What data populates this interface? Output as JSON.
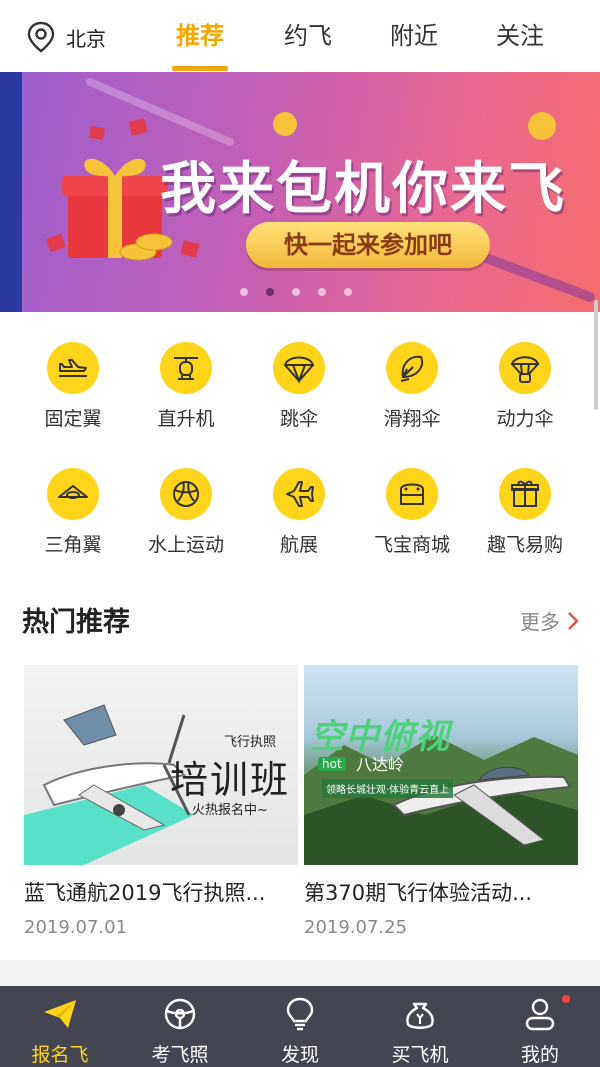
{
  "topbar": {
    "location": "北京",
    "tabs": [
      {
        "label": "推荐",
        "active": true
      },
      {
        "label": "约飞",
        "active": false
      },
      {
        "label": "附近",
        "active": false
      },
      {
        "label": "关注",
        "active": false
      }
    ]
  },
  "banner": {
    "title": "我来包机你来飞",
    "button_label": "快一起来参加吧",
    "dot_count": 5,
    "active_dot": 2
  },
  "categories": [
    {
      "label": "固定翼",
      "icon": "fixed-wing-icon"
    },
    {
      "label": "直升机",
      "icon": "helicopter-icon"
    },
    {
      "label": "跳伞",
      "icon": "parachute-icon"
    },
    {
      "label": "滑翔伞",
      "icon": "paraglider-icon"
    },
    {
      "label": "动力伞",
      "icon": "powered-paraglider-icon"
    },
    {
      "label": "三角翼",
      "icon": "hang-glider-icon"
    },
    {
      "label": "水上运动",
      "icon": "water-sports-icon"
    },
    {
      "label": "航展",
      "icon": "airshow-icon"
    },
    {
      "label": "飞宝商城",
      "icon": "store-icon"
    },
    {
      "label": "趣飞易购",
      "icon": "gift-icon"
    }
  ],
  "hot": {
    "title": "热门推荐",
    "more_label": "更多",
    "cards": [
      {
        "title": "蓝飞通航2019飞行执照...",
        "date": "2019.07.01",
        "image_text_main": "培训班",
        "image_text_small": "飞行执照",
        "image_text_sub": "火热报名中~"
      },
      {
        "title": "第370期飞行体验活动...",
        "date": "2019.07.25",
        "image_text_main": "空中俯视",
        "image_text_small": "八达岭",
        "image_text_sub": "领略长城壮观·体验青云直上",
        "image_text_tag": "hot"
      }
    ]
  },
  "bottomnav": [
    {
      "label": "报名飞",
      "icon": "paper-plane-icon",
      "active": true
    },
    {
      "label": "考飞照",
      "icon": "steering-wheel-icon",
      "active": false
    },
    {
      "label": "发现",
      "icon": "lightbulb-icon",
      "active": false
    },
    {
      "label": "买飞机",
      "icon": "money-bag-icon",
      "active": false
    },
    {
      "label": "我的",
      "icon": "user-icon",
      "active": false
    }
  ],
  "colors": {
    "accent": "#f5a800",
    "icon_bg": "#ffd41a",
    "nav_bg": "#434650"
  }
}
